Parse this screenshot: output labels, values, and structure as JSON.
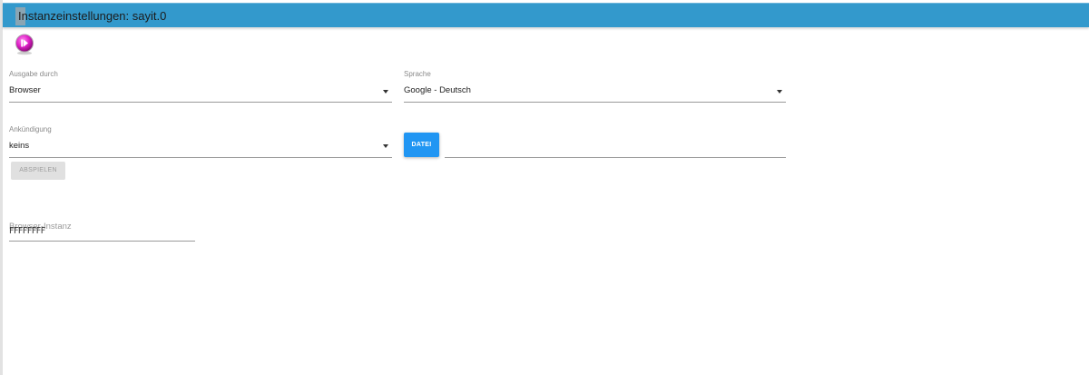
{
  "window": {
    "title": "Instanzeinstellungen: sayit.0",
    "accent_color": "#3399cc",
    "logo_icon": "sayit-play-logo-icon"
  },
  "settings": {
    "output": {
      "label": "Ausgabe durch",
      "value": "Browser"
    },
    "language": {
      "label": "Sprache",
      "value": "Google - Deutsch"
    },
    "announcement": {
      "label": "Ankündigung",
      "value": "keins"
    },
    "file_button_label": "DATEI",
    "play_button_label": "ABSPIELEN",
    "browser_instance": {
      "placeholder": "Browser-Instanz",
      "value": "FFFFFFFF"
    }
  },
  "colors": {
    "file_button": "#2196f3",
    "play_button_disabled": "#e0e0e0"
  }
}
